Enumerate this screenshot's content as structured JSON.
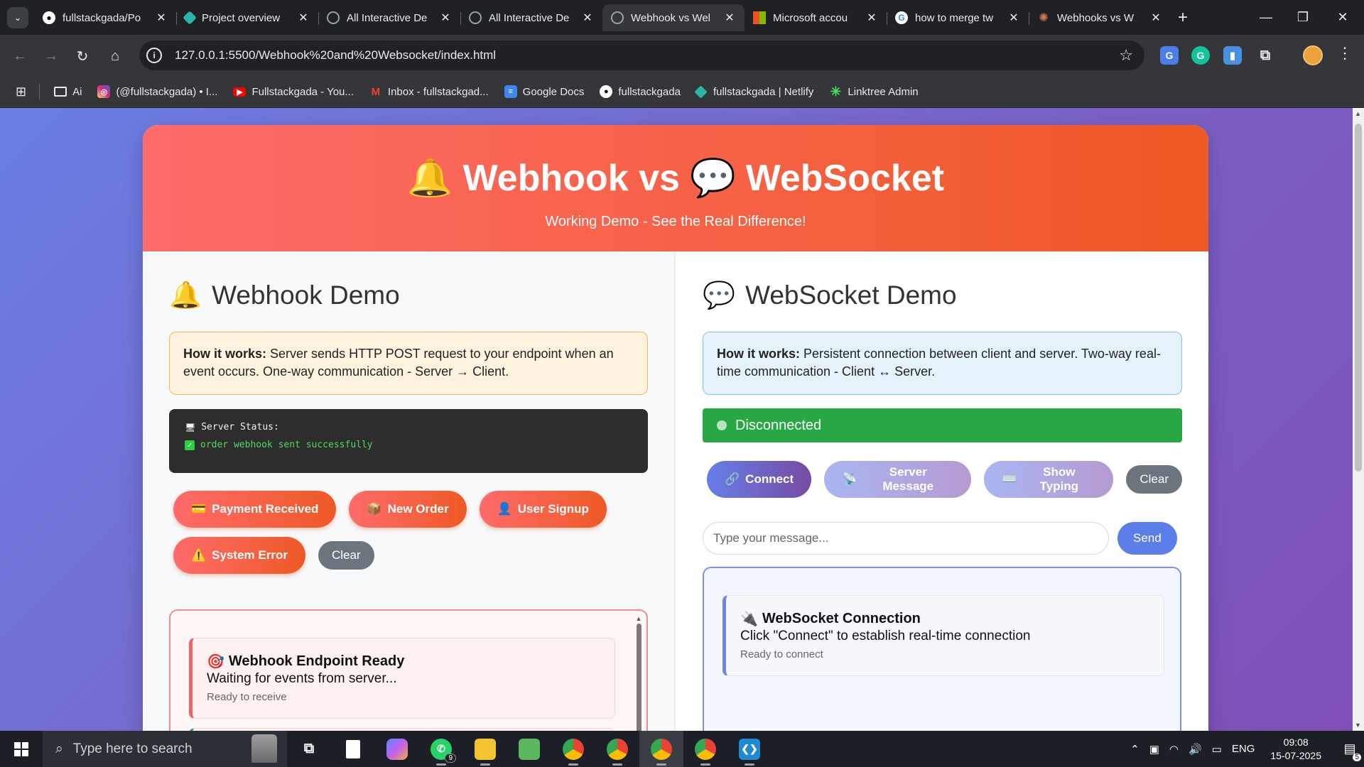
{
  "browser": {
    "tabs": [
      {
        "title": "fullstackgada/Po",
        "icon": "github-icon",
        "color": "#ffffff"
      },
      {
        "title": "Project overview",
        "icon": "netlify-icon",
        "color": "#2bb5a8"
      },
      {
        "title": "All Interactive De",
        "icon": "globe-icon",
        "color": "#9aa0a6"
      },
      {
        "title": "All Interactive De",
        "icon": "globe-icon",
        "color": "#9aa0a6"
      },
      {
        "title": "Webhook vs Wel",
        "icon": "globe-icon",
        "color": "#9aa0a6",
        "active": true
      },
      {
        "title": "Microsoft accou",
        "icon": "microsoft-icon",
        "color": "#f25022"
      },
      {
        "title": "how to merge tw",
        "icon": "google-icon",
        "color": "#4285f4"
      },
      {
        "title": "Webhooks vs W",
        "icon": "claude-icon",
        "color": "#d97757"
      }
    ],
    "url": "127.0.0.1:5500/Webhook%20and%20Websocket/index.html",
    "bookmarks": [
      {
        "label": "Ai",
        "icon": "folder-icon",
        "color": "#35363a"
      },
      {
        "label": "(@fullstackgada) • I...",
        "icon": "instagram-icon",
        "color": "#d6249f"
      },
      {
        "label": "Fullstackgada - You...",
        "icon": "youtube-icon",
        "color": "#ff0000"
      },
      {
        "label": "Inbox - fullstackgad...",
        "icon": "gmail-icon",
        "color": "#ea4335"
      },
      {
        "label": "Google Docs",
        "icon": "docs-icon",
        "color": "#4285f4"
      },
      {
        "label": "fullstackgada",
        "icon": "github-icon",
        "color": "#35363a"
      },
      {
        "label": "fullstackgada | Netlify",
        "icon": "netlify-icon",
        "color": "#2bb5a8"
      },
      {
        "label": "Linktree Admin",
        "icon": "linktree-icon",
        "color": "#43e55e"
      }
    ]
  },
  "page": {
    "title_left_icon": "🔔",
    "title_part1": "Webhook vs",
    "title_right_icon": "💬",
    "title_part2": "WebSocket",
    "subtitle": "Working Demo - See the Real Difference!"
  },
  "webhook": {
    "heading_icon": "🔔",
    "heading": "Webhook Demo",
    "how_label": "How it works:",
    "how_text": " Server sends HTTP POST request to your endpoint when an event occurs. One-way communication - Server → Client.",
    "status_label": "Server Status:",
    "status_text": "order webhook sent successfully",
    "buttons": [
      {
        "icon": "💳",
        "label": "Payment Received"
      },
      {
        "icon": "📦",
        "label": "New Order"
      },
      {
        "icon": "👤",
        "label": "User Signup"
      },
      {
        "icon": "⚠️",
        "label": "System Error"
      }
    ],
    "clear_label": "Clear",
    "log": {
      "icon": "🎯",
      "title": "Webhook Endpoint Ready",
      "body": "Waiting for events from server...",
      "status": "Ready to receive"
    }
  },
  "websocket": {
    "heading_icon": "💬",
    "heading": "WebSocket Demo",
    "how_label": "How it works:",
    "how_text": " Persistent connection between client and server. Two-way real-time communication - Client ↔ Server.",
    "connection_status": "Disconnected",
    "buttons": [
      {
        "icon": "🔗",
        "label": "Connect"
      },
      {
        "icon": "📡",
        "label": "Server Message"
      },
      {
        "icon": "⌨️",
        "label": "Show Typing"
      }
    ],
    "clear_label": "Clear",
    "input_placeholder": "Type your message...",
    "send_label": "Send",
    "log": {
      "icon": "🔌",
      "title": "WebSocket Connection",
      "body": "Click \"Connect\" to establish real-time connection",
      "status": "Ready to connect"
    }
  },
  "taskbar": {
    "search_placeholder": "Type here to search",
    "whatsapp_badge": "9",
    "language": "ENG",
    "time": "09:08",
    "date": "15-07-2025",
    "notifications": "5"
  }
}
